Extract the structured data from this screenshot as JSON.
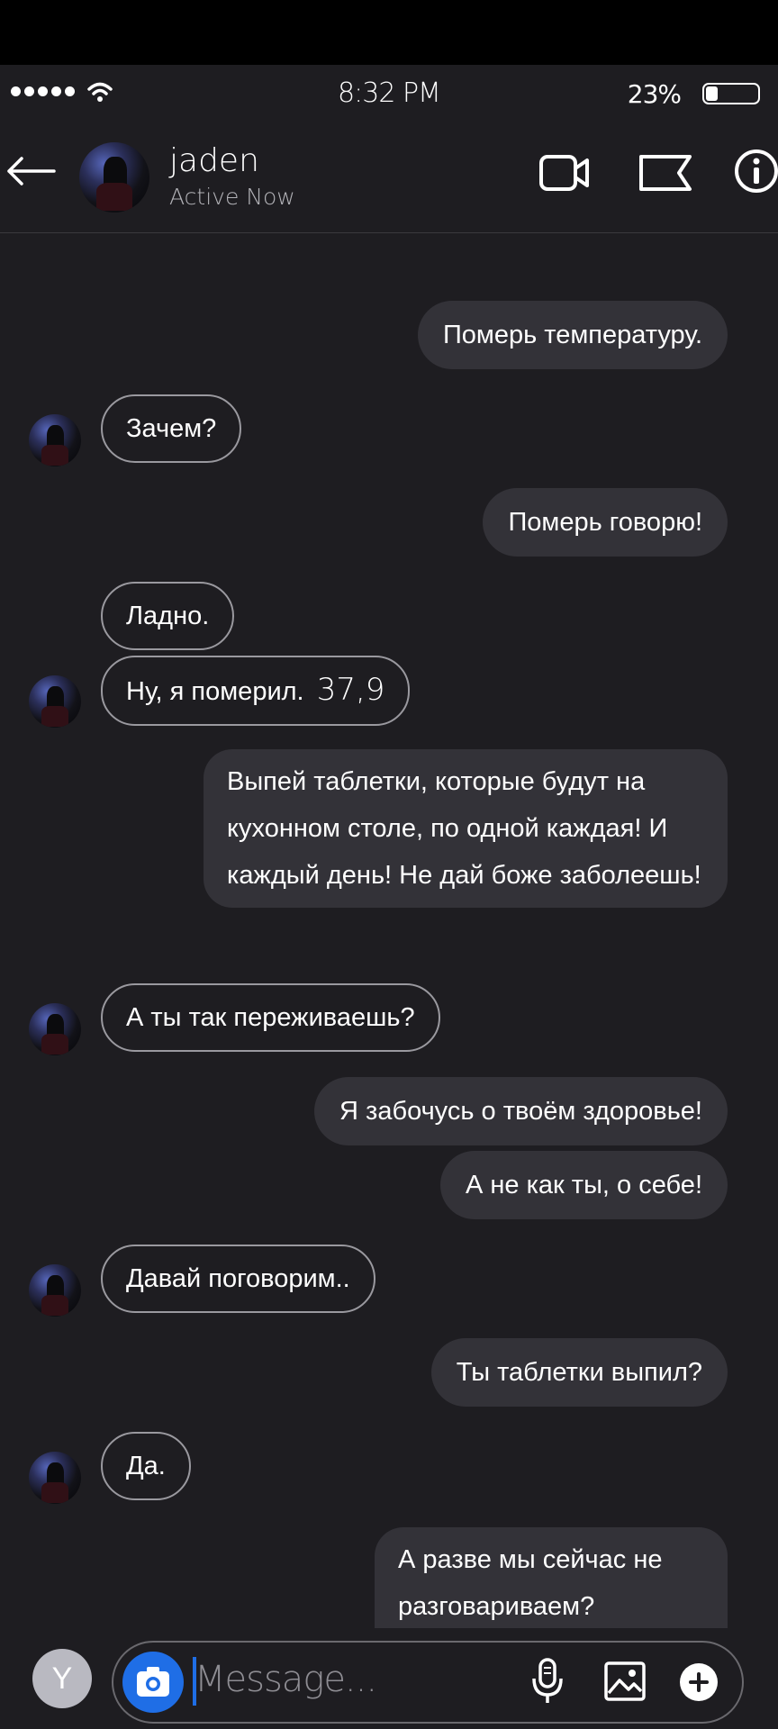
{
  "status_bar": {
    "time": "8:32 PM",
    "battery_percent": "23%",
    "battery_level": 0.23
  },
  "header": {
    "contact_name": "jaden",
    "contact_status": "Active Now",
    "icons": [
      "back-arrow-icon",
      "video-call-icon",
      "flag-icon",
      "info-icon"
    ]
  },
  "messages": [
    {
      "from": "me",
      "text": "Померь температуру."
    },
    {
      "from": "jaden",
      "text": "Зачем?"
    },
    {
      "from": "me",
      "text": "Померь говорю!"
    },
    {
      "from": "jaden",
      "text": "Ладно."
    },
    {
      "from": "jaden",
      "text": "Ну, я померил.",
      "extra": "37,9"
    },
    {
      "from": "me",
      "text": "Выпей таблетки, которые будут на кухонном столе, по одной каждая! И каждый день! Не дай боже заболеешь!"
    },
    {
      "from": "jaden",
      "text": "А ты так переживаешь?"
    },
    {
      "from": "me",
      "text": "Я забочусь о твоём здоровье!"
    },
    {
      "from": "me",
      "text": "А не как ты, о себе!"
    },
    {
      "from": "jaden",
      "text": "Давай поговорим.."
    },
    {
      "from": "me",
      "text": "Ты таблетки выпил?"
    },
    {
      "from": "jaden",
      "text": "Да."
    },
    {
      "from": "me",
      "text": "А разве мы сейчас не разговариваем?"
    }
  ],
  "composer": {
    "self_avatar_letter": "Y",
    "placeholder": "Message...",
    "icons": [
      "camera-icon",
      "microphone-icon",
      "gallery-icon",
      "plus-icon"
    ]
  },
  "colors": {
    "background": "#1e1d21",
    "outgoing_bubble": "#333238",
    "incoming_border": "#9a999f",
    "accent": "#1f6ee6"
  }
}
